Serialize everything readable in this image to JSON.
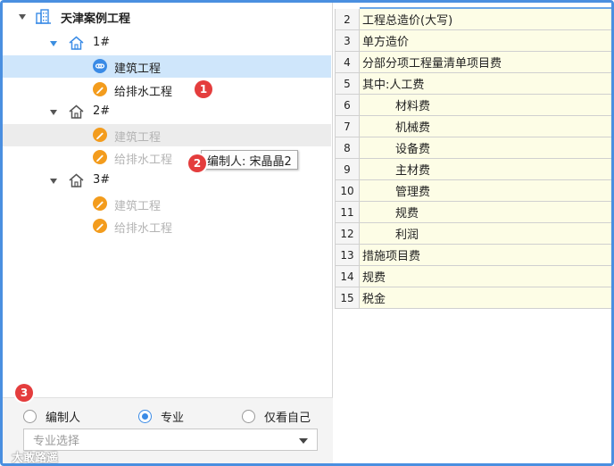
{
  "tree": {
    "root": {
      "label": "天津案例工程",
      "icon": "building-icon"
    },
    "groups": [
      {
        "label": "1#",
        "icon": "house-icon",
        "items": [
          {
            "label": "建筑工程",
            "icon": "link-icon",
            "state": "selected"
          },
          {
            "label": "给排水工程",
            "icon": "pencil-icon",
            "state": "normal"
          }
        ]
      },
      {
        "label": "2#",
        "icon": "house-icon",
        "items": [
          {
            "label": "建筑工程",
            "icon": "pencil-icon",
            "state": "disabled"
          },
          {
            "label": "给排水工程",
            "icon": "pencil-icon",
            "state": "disabled"
          }
        ]
      },
      {
        "label": "3#",
        "icon": "house-icon",
        "items": [
          {
            "label": "建筑工程",
            "icon": "pencil-icon",
            "state": "disabled"
          },
          {
            "label": "给排水工程",
            "icon": "pencil-icon",
            "state": "disabled"
          }
        ]
      }
    ]
  },
  "tooltip": "编制人: 宋晶晶2",
  "badges": [
    "1",
    "2",
    "3"
  ],
  "filter": {
    "options": [
      "编制人",
      "专业",
      "仅看自己"
    ],
    "selected": "专业",
    "select_placeholder": "专业选择"
  },
  "watermark": "大敢路遥",
  "table": {
    "rows": [
      {
        "num": "2",
        "label": "工程总造价(大写)",
        "indent": false
      },
      {
        "num": "3",
        "label": "单方造价",
        "indent": false
      },
      {
        "num": "4",
        "label": "分部分项工程量清单项目费",
        "indent": false
      },
      {
        "num": "5",
        "label": "其中:人工费",
        "indent": false
      },
      {
        "num": "6",
        "label": "材料费",
        "indent": true
      },
      {
        "num": "7",
        "label": "机械费",
        "indent": true
      },
      {
        "num": "8",
        "label": "设备费",
        "indent": true
      },
      {
        "num": "9",
        "label": "主材费",
        "indent": true
      },
      {
        "num": "10",
        "label": "管理费",
        "indent": true
      },
      {
        "num": "11",
        "label": "规费",
        "indent": true
      },
      {
        "num": "12",
        "label": "利润",
        "indent": true
      },
      {
        "num": "13",
        "label": "措施项目费",
        "indent": false
      },
      {
        "num": "14",
        "label": "规费",
        "indent": false
      },
      {
        "num": "15",
        "label": "税金",
        "indent": false
      }
    ]
  },
  "colors": {
    "accent": "#3a8be6",
    "badge": "#e43d3d",
    "pencil": "#f39c1d",
    "selected_row": "#cfe6fb",
    "cell_bg": "#fdfde6"
  }
}
